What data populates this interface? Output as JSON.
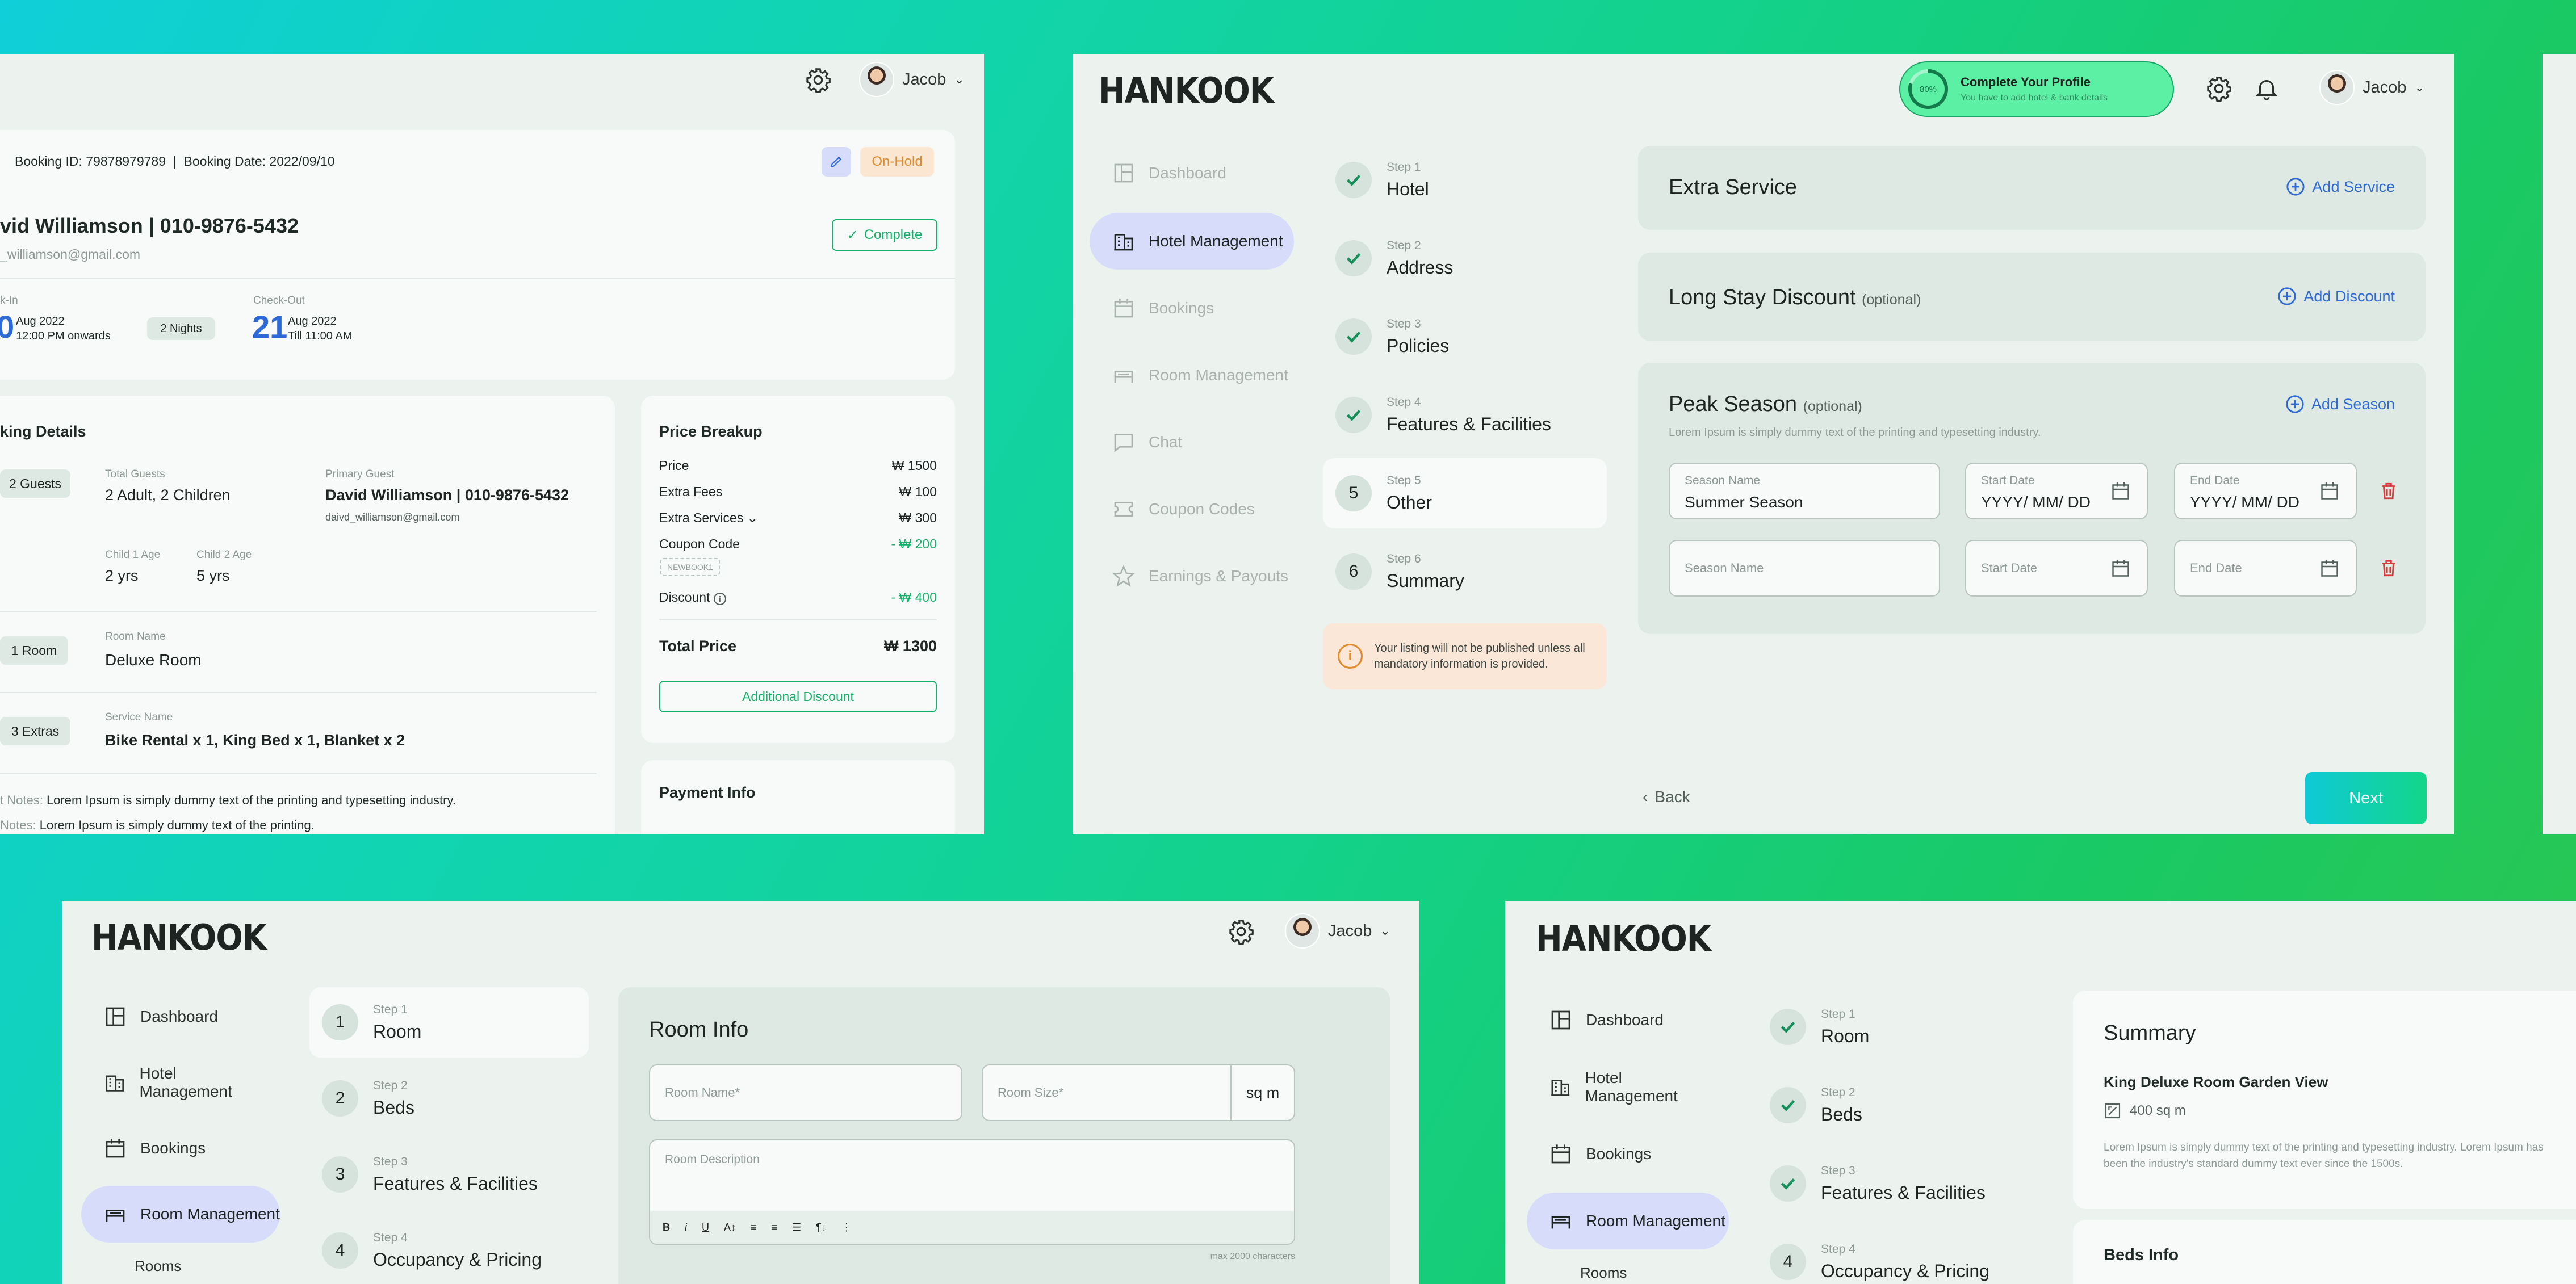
{
  "user": {
    "name": "Jacob"
  },
  "booking": {
    "id_line": "Booking ID: 79878979789  |  Booking Date: 2022/09/10",
    "status": "On-Hold",
    "guest_line": "vid Williamson | 010-9876-5432",
    "email": "_williamson@gmail.com",
    "complete_label": "Complete",
    "checkin_label": "k-In",
    "checkin_day": "0",
    "checkin_month": "Aug 2022",
    "checkin_time": "12:00 PM onwards",
    "nights": "2 Nights",
    "checkout_label": "Check-Out",
    "checkout_day": "21",
    "checkout_month": "Aug 2022",
    "checkout_time": "Till 11:00 AM",
    "details_title": "king Details",
    "guests_chip": "2 Guests",
    "total_guests_label": "Total Guests",
    "total_guests": "2 Adult, 2 Children",
    "primary_guest_label": "Primary Guest",
    "primary_guest": "David Williamson | 010-9876-5432",
    "primary_email": "daivd_williamson@gmail.com",
    "child1_label": "Child 1 Age",
    "child1": "2 yrs",
    "child2_label": "Child 2 Age",
    "child2": "5 yrs",
    "room_chip": "1 Room",
    "room_name_label": "Room Name",
    "room_name": "Deluxe Room",
    "extras_chip": "3 Extras",
    "service_label": "Service Name",
    "service": "Bike Rental x 1, King Bed x 1, Blanket x 2",
    "notes1_label": "t Notes:",
    "notes1": "Lorem Ipsum is simply dummy text of the printing and typesetting industry.",
    "notes2_label": "Notes:",
    "notes2": "Lorem Ipsum is simply dummy text of the printing."
  },
  "price": {
    "title": "Price Breakup",
    "rows": [
      {
        "label": "Price",
        "value": "₩ 1500"
      },
      {
        "label": "Extra Fees",
        "value": "₩ 100"
      },
      {
        "label": "Extra Services",
        "value": "₩ 300"
      },
      {
        "label": "Coupon Code",
        "value": "- ₩ 200"
      },
      {
        "label": "Discount",
        "value": "- ₩ 400"
      }
    ],
    "coupon": "NEWBOOK1",
    "total_label": "Total Price",
    "total": "₩ 1300",
    "additional_discount": "Additional Discount",
    "payment_title": "Payment Info"
  },
  "brand": "HANKOOK",
  "profile": {
    "percent": "80%",
    "title": "Complete Your Profile",
    "sub": "You have to add hotel & bank details"
  },
  "nav": {
    "dashboard": "Dashboard",
    "hotel": "Hotel Management",
    "bookings": "Bookings",
    "room": "Room Management",
    "chat": "Chat",
    "coupons": "Coupon Codes",
    "earnings": "Earnings & Payouts",
    "rooms": "Rooms"
  },
  "hotel_steps": [
    {
      "k": "Step 1",
      "n": "Hotel"
    },
    {
      "k": "Step 2",
      "n": "Address"
    },
    {
      "k": "Step 3",
      "n": "Policies"
    },
    {
      "k": "Step 4",
      "n": "Features & Facilities"
    },
    {
      "k": "Step 5",
      "n": "Other",
      "num": "5"
    },
    {
      "k": "Step 6",
      "n": "Summary",
      "num": "6"
    }
  ],
  "warning": "Your listing will not be published unless all mandatory information is provided.",
  "extra_service": {
    "title": "Extra Service",
    "add": "Add Service"
  },
  "long_stay": {
    "title": "Long Stay Discount",
    "optional": "(optional)",
    "add": "Add Discount"
  },
  "peak": {
    "title": "Peak Season",
    "optional": "(optional)",
    "add": "Add Season",
    "desc": "Lorem Ipsum is simply dummy text of the printing and typesetting industry.",
    "season_name_label": "Season Name",
    "season_name_value": "Summer Season",
    "start_label": "Start Date",
    "end_label": "End Date",
    "date_placeholder": "YYYY/ MM/ DD"
  },
  "back": "Back",
  "next": "Next",
  "room_steps": [
    {
      "num": "1",
      "k": "Step 1",
      "n": "Room"
    },
    {
      "num": "2",
      "k": "Step 2",
      "n": "Beds"
    },
    {
      "num": "3",
      "k": "Step 3",
      "n": "Features & Facilities"
    },
    {
      "num": "4",
      "k": "Step 4",
      "n": "Occupancy & Pricing"
    }
  ],
  "room_info": {
    "title": "Room Info",
    "name_label": "Room Name*",
    "size_label": "Room Size*",
    "unit": "sq m",
    "desc_label": "Room Description",
    "max": "max 2000 characters",
    "toolbar": [
      "B",
      "i",
      "U",
      "A↕",
      "≡",
      "≡",
      "☰",
      "¶↓",
      "⋮"
    ]
  },
  "summary": {
    "title": "Summary",
    "room": "King Deluxe Room Garden View",
    "size": "400 sq m",
    "desc": "Lorem Ipsum is simply dummy text of the printing and typesetting industry. Lorem Ipsum has been the industry's standard dummy text ever since the 1500s.",
    "beds_title": "Beds Info"
  },
  "colors": {
    "accent": "#16b06a",
    "blue": "#2d6ad8",
    "red": "#d63a3a",
    "next_start": "#0fc9d6",
    "next_end": "#13d68a"
  }
}
